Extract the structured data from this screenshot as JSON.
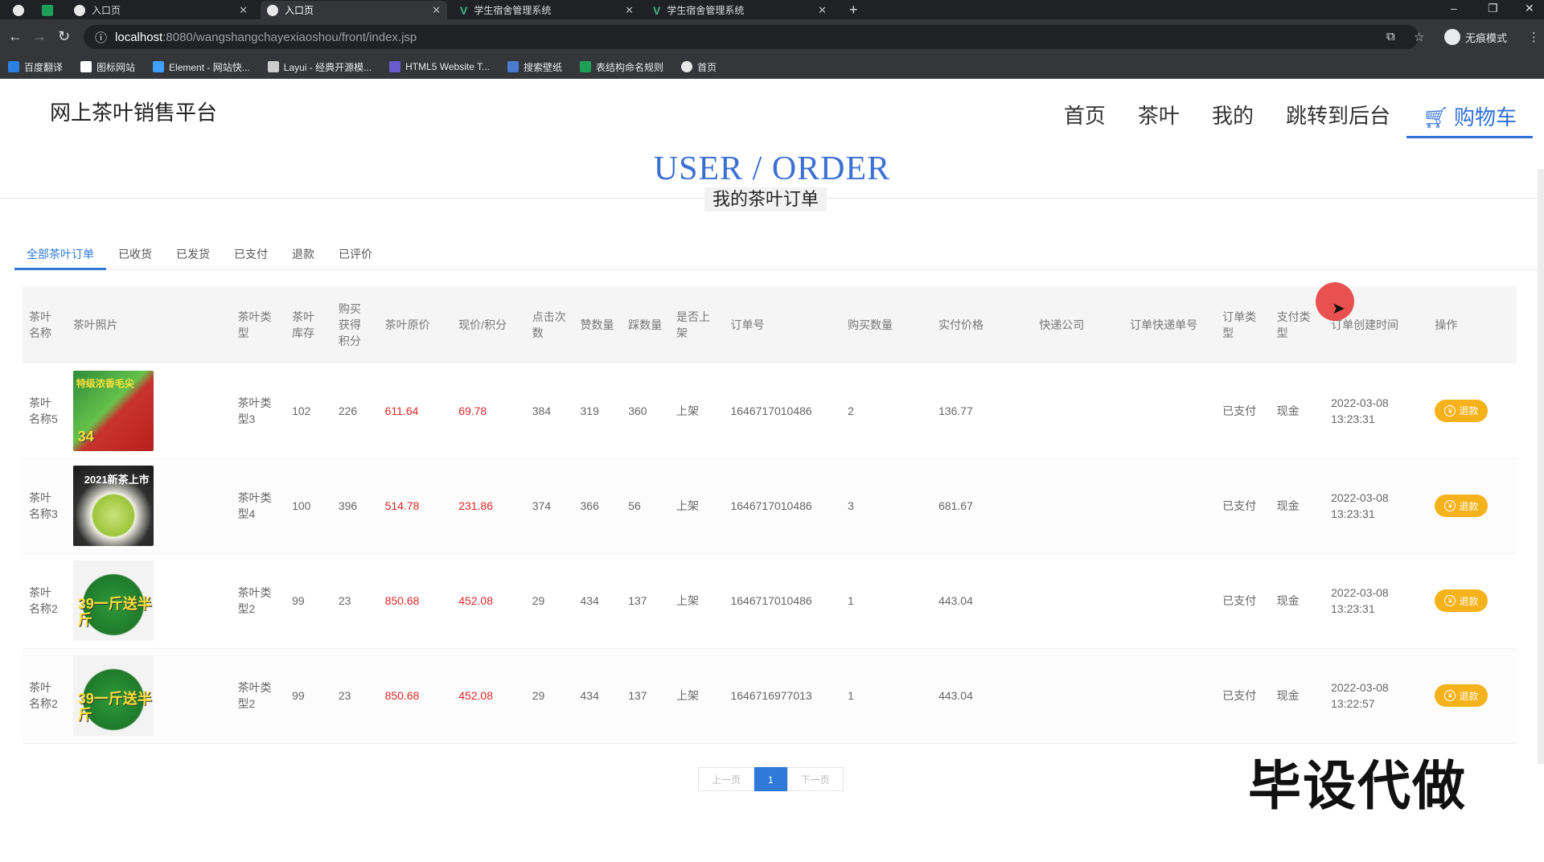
{
  "browser": {
    "tabs": [
      {
        "title": ""
      },
      {
        "title": ""
      },
      {
        "title": "入口页"
      },
      {
        "title": "入口页"
      },
      {
        "title": "学生宿舍管理系统"
      },
      {
        "title": "学生宿舍管理系统"
      }
    ],
    "url_host": "localhost",
    "url_path": ":8080/wangshangchayexiaoshou/front/index.jsp",
    "incognito_label": "无痕模式",
    "bookmarks": [
      "百度翻译",
      "图标网站",
      "Element - 网站快...",
      "Layui - 经典开源模...",
      "HTML5 Website T...",
      "搜索壁纸",
      "表结构命名规则",
      "首页"
    ]
  },
  "site": {
    "brand": "网上茶叶销售平台",
    "nav": [
      "首页",
      "茶叶",
      "我的",
      "跳转到后台",
      "购物车"
    ]
  },
  "hero": {
    "title": "USER / ORDER",
    "subtitle": "我的茶叶订单"
  },
  "filter_tabs": [
    "全部茶叶订单",
    "已收货",
    "已发货",
    "已支付",
    "退款",
    "已评价"
  ],
  "table": {
    "headers": [
      "茶叶名称",
      "茶叶照片",
      "茶叶类型",
      "茶叶库存",
      "购买获得积分",
      "茶叶原价",
      "现价/积分",
      "点击次数",
      "赞数量",
      "踩数量",
      "是否上架",
      "订单号",
      "购买数量",
      "实付价格",
      "快递公司",
      "订单快递单号",
      "订单类型",
      "支付类型",
      "订单创建时间",
      "操作"
    ],
    "rows": [
      {
        "name": "茶叶名称5",
        "photo": "thumb-a",
        "type": "茶叶类型3",
        "stock": "102",
        "points": "226",
        "orig": "611.64",
        "price": "69.78",
        "clicks": "384",
        "likes": "319",
        "dislikes": "360",
        "onshelf": "上架",
        "order_no": "1646717010486",
        "qty": "2",
        "paid": "136.77",
        "express": "",
        "express_no": "",
        "order_type": "已支付",
        "pay_type": "现金",
        "created": "2022-03-08 13:23:31",
        "action": "退款"
      },
      {
        "name": "茶叶名称3",
        "photo": "thumb-b",
        "type": "茶叶类型4",
        "stock": "100",
        "points": "396",
        "orig": "514.78",
        "price": "231.86",
        "clicks": "374",
        "likes": "366",
        "dislikes": "56",
        "onshelf": "上架",
        "order_no": "1646717010486",
        "qty": "3",
        "paid": "681.67",
        "express": "",
        "express_no": "",
        "order_type": "已支付",
        "pay_type": "现金",
        "created": "2022-03-08 13:23:31",
        "action": "退款"
      },
      {
        "name": "茶叶名称2",
        "photo": "thumb-c",
        "type": "茶叶类型2",
        "stock": "99",
        "points": "23",
        "orig": "850.68",
        "price": "452.08",
        "clicks": "29",
        "likes": "434",
        "dislikes": "137",
        "onshelf": "上架",
        "order_no": "1646717010486",
        "qty": "1",
        "paid": "443.04",
        "express": "",
        "express_no": "",
        "order_type": "已支付",
        "pay_type": "现金",
        "created": "2022-03-08 13:23:31",
        "action": "退款"
      },
      {
        "name": "茶叶名称2",
        "photo": "thumb-c",
        "type": "茶叶类型2",
        "stock": "99",
        "points": "23",
        "orig": "850.68",
        "price": "452.08",
        "clicks": "29",
        "likes": "434",
        "dislikes": "137",
        "onshelf": "上架",
        "order_no": "1646716977013",
        "qty": "1",
        "paid": "443.04",
        "express": "",
        "express_no": "",
        "order_type": "已支付",
        "pay_type": "现金",
        "created": "2022-03-08 13:22:57",
        "action": "退款"
      }
    ]
  },
  "thumb_text": {
    "a_promo": "特级浓香毛尖",
    "a_price": "34",
    "b_promo": "2021新茶上市",
    "c_promo": "39一斤送半斤"
  },
  "pager": {
    "prev": "上一页",
    "current": "1",
    "next": "下一页"
  },
  "watermark": "毕设代做",
  "colors": {
    "accent": "#2f7ad8",
    "title_blue": "#3b6fd4",
    "price_red": "#e02828",
    "refund_yellow": "#f6b21a"
  }
}
